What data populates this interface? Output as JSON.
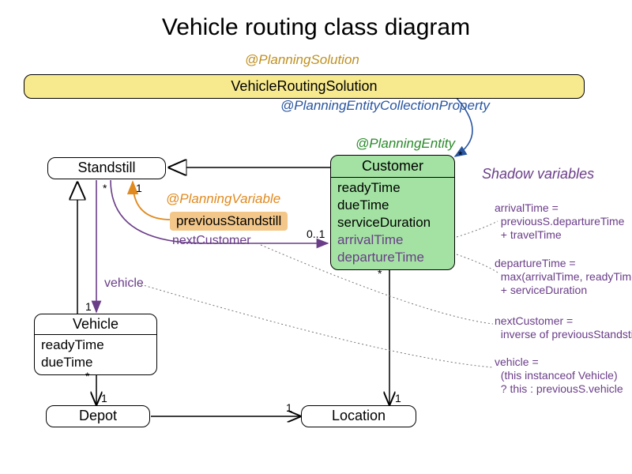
{
  "title": "Vehicle routing class diagram",
  "annotations": {
    "planning_solution": "@PlanningSolution",
    "planning_entity_collection_property": "@PlanningEntityCollectionProperty",
    "planning_entity": "@PlanningEntity",
    "planning_variable": "@PlanningVariable"
  },
  "classes": {
    "solution": "VehicleRoutingSolution",
    "standstill": "Standstill",
    "customer": {
      "name": "Customer",
      "attrs": [
        "readyTime",
        "dueTime",
        "serviceDuration"
      ],
      "shadow_attrs": [
        "arrivalTime",
        "departureTime"
      ]
    },
    "vehicle": {
      "name": "Vehicle",
      "attrs": [
        "readyTime",
        "dueTime"
      ]
    },
    "depot": "Depot",
    "location": "Location"
  },
  "refs": {
    "previous_standstill": "previousStandstill",
    "next_customer": "nextCustomer",
    "vehicle": "vehicle"
  },
  "multiplicities": {
    "star": "*",
    "one": "1",
    "zero_one": "0..1"
  },
  "shadow": {
    "title": "Shadow variables",
    "arrival": "arrivalTime =\n  previousS.departureTime\n  + travelTime",
    "departure": "departureTime =\n  max(arrivalTime, readyTime)\n  + serviceDuration",
    "next": "nextCustomer =\n  inverse of previousStandstill",
    "vehicle": "vehicle =\n  (this instanceof Vehicle)\n  ? this : previousS.vehicle"
  }
}
